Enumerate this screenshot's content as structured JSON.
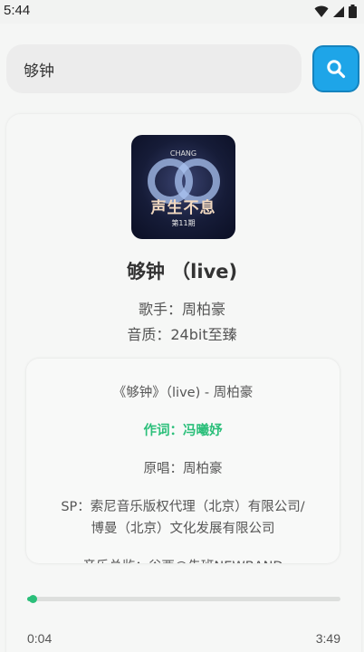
{
  "status_bar": {
    "time": "5:44",
    "icons": [
      "wifi-icon",
      "signal-icon",
      "battery-icon"
    ]
  },
  "search": {
    "value": "够钟",
    "placeholder": "",
    "button_icon": "search-icon",
    "button_color": "#1ea5e8"
  },
  "song": {
    "title": "够钟 （live)",
    "singer": "歌手：周柏豪",
    "quality": "音质：24bit至臻",
    "cover": {
      "brand": "CHANG",
      "title": "声生不息",
      "subtitle": "第11期"
    }
  },
  "lyrics": [
    {
      "text": "《够钟》（live) - 周柏豪",
      "active": false
    },
    {
      "text": "作词：冯曦妤",
      "active": true
    },
    {
      "text": "原唱：周柏豪",
      "active": false
    },
    {
      "text": "SP：索尼音乐版权代理（北京）有限公司/",
      "active": false
    },
    {
      "text": "博曼（北京）文化发展有限公司",
      "active": false
    },
    {
      "text": "音乐总监：谷西@先班NEWBAND",
      "active": false
    }
  ],
  "player": {
    "current_time": "0:04",
    "total_time": "3:49",
    "progress": 0.018,
    "accent_color": "#2bbf7a"
  }
}
